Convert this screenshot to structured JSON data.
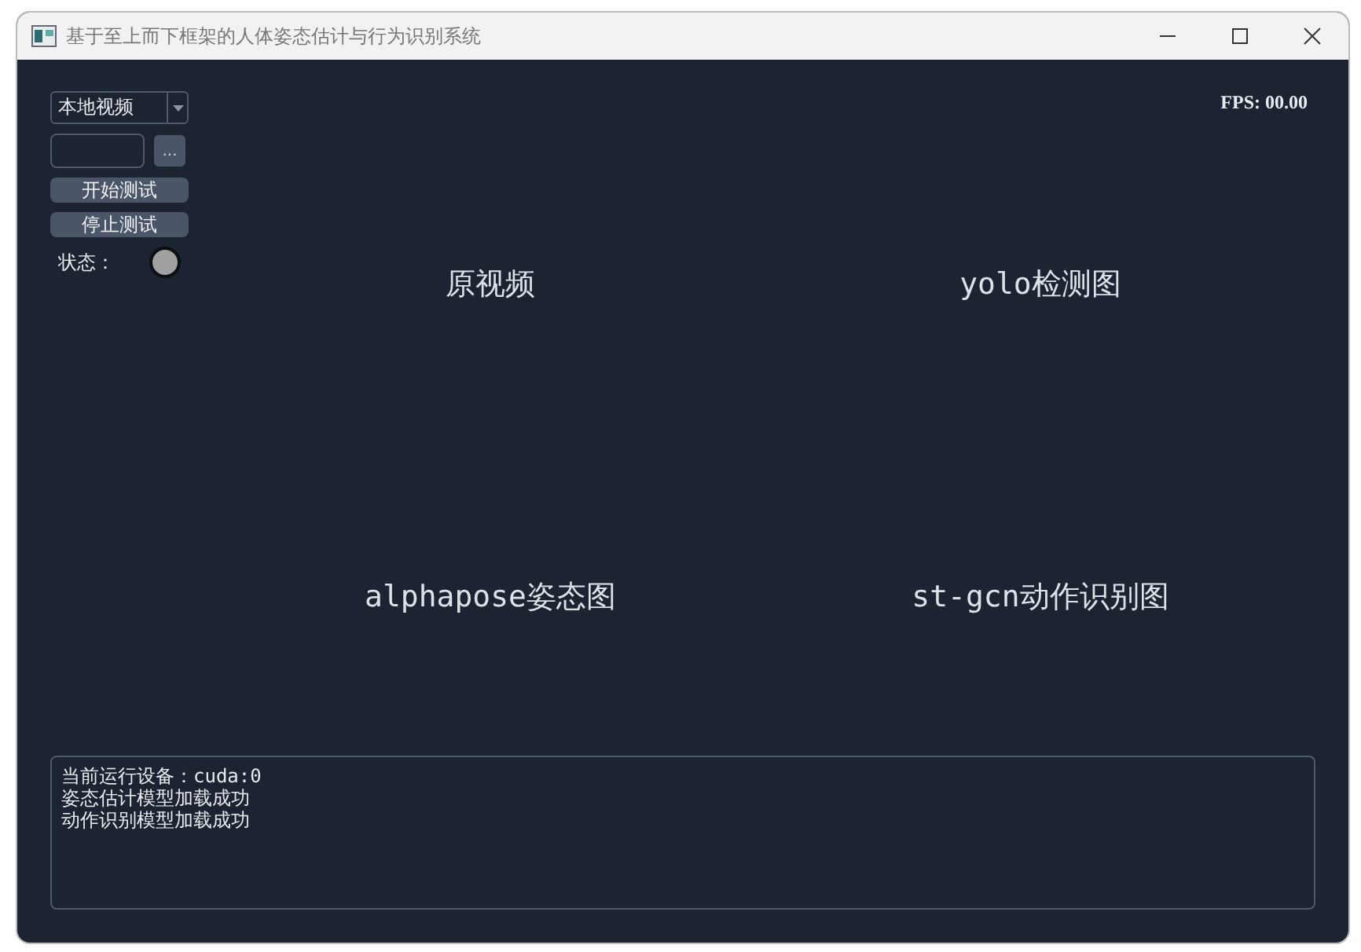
{
  "window": {
    "title": "基于至上而下框架的人体姿态估计与行为识别系统"
  },
  "source_select": {
    "value": "本地视频"
  },
  "path_field": {
    "browse_label": "..."
  },
  "buttons": [
    "开始测试",
    "停止测试"
  ],
  "status": {
    "label": "状态：",
    "color": "#a0a0a0"
  },
  "fps": "FPS: 00.00",
  "views": [
    {
      "label": "原视频"
    },
    {
      "label": "yolo检测图"
    },
    {
      "label": "alphapose姿态图"
    },
    {
      "label": "st-gcn动作识别图"
    }
  ],
  "log": [
    "当前运行设备：cuda:0",
    "姿态估计模型加载成功",
    "动作识别模型加载成功"
  ]
}
